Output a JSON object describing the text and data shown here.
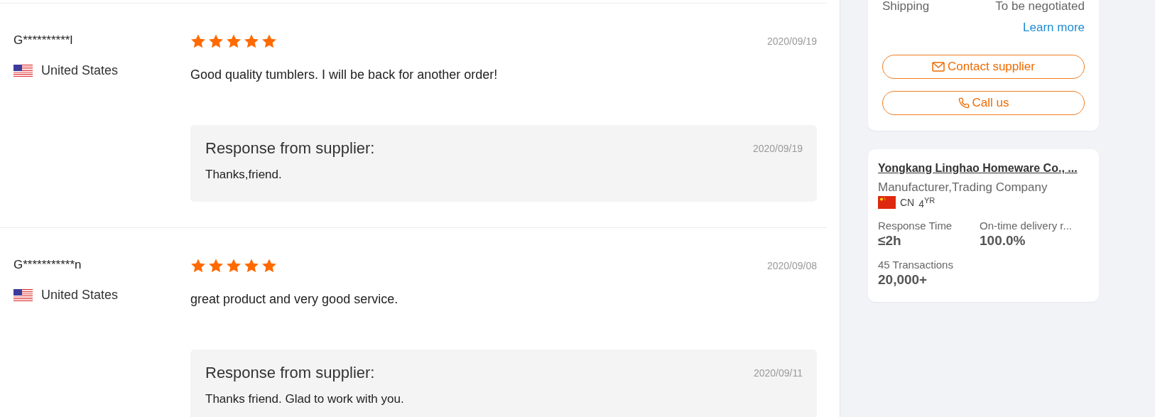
{
  "reviews": [
    {
      "reviewer": "G**********l",
      "country": "United States",
      "stars": 5,
      "date": "2020/09/19",
      "comment": "Good quality tumblers. I will be back for another order!",
      "response": {
        "title": "Response from supplier:",
        "date": "2020/09/19",
        "text": "Thanks,friend."
      }
    },
    {
      "reviewer": "G***********n",
      "country": "United States",
      "stars": 5,
      "date": "2020/09/08",
      "comment": "great product and very good service.",
      "response": {
        "title": "Response from supplier:",
        "date": "2020/09/11",
        "text": "Thanks friend. Glad to work with you."
      }
    }
  ],
  "contact_card": {
    "shipping_label": "Shipping",
    "shipping_value": "To be negotiated",
    "learn_more": "Learn more",
    "buttons": [
      {
        "kind": "mail",
        "label": "Contact supplier"
      },
      {
        "kind": "phone",
        "label": "Call us"
      }
    ]
  },
  "supplier_card": {
    "name": "Yongkang Linghao Homeware Co., ...",
    "type": "Manufacturer,Trading Company",
    "country": "CN",
    "years": "4$^{YR}$",
    "stats": [
      {
        "label": "Response Time",
        "value": "≤2h"
      },
      {
        "label": "On-time delivery r...",
        "value": "100.0%"
      },
      {
        "label": "45 Transactions",
        "value": "20,000+"
      }
    ]
  }
}
